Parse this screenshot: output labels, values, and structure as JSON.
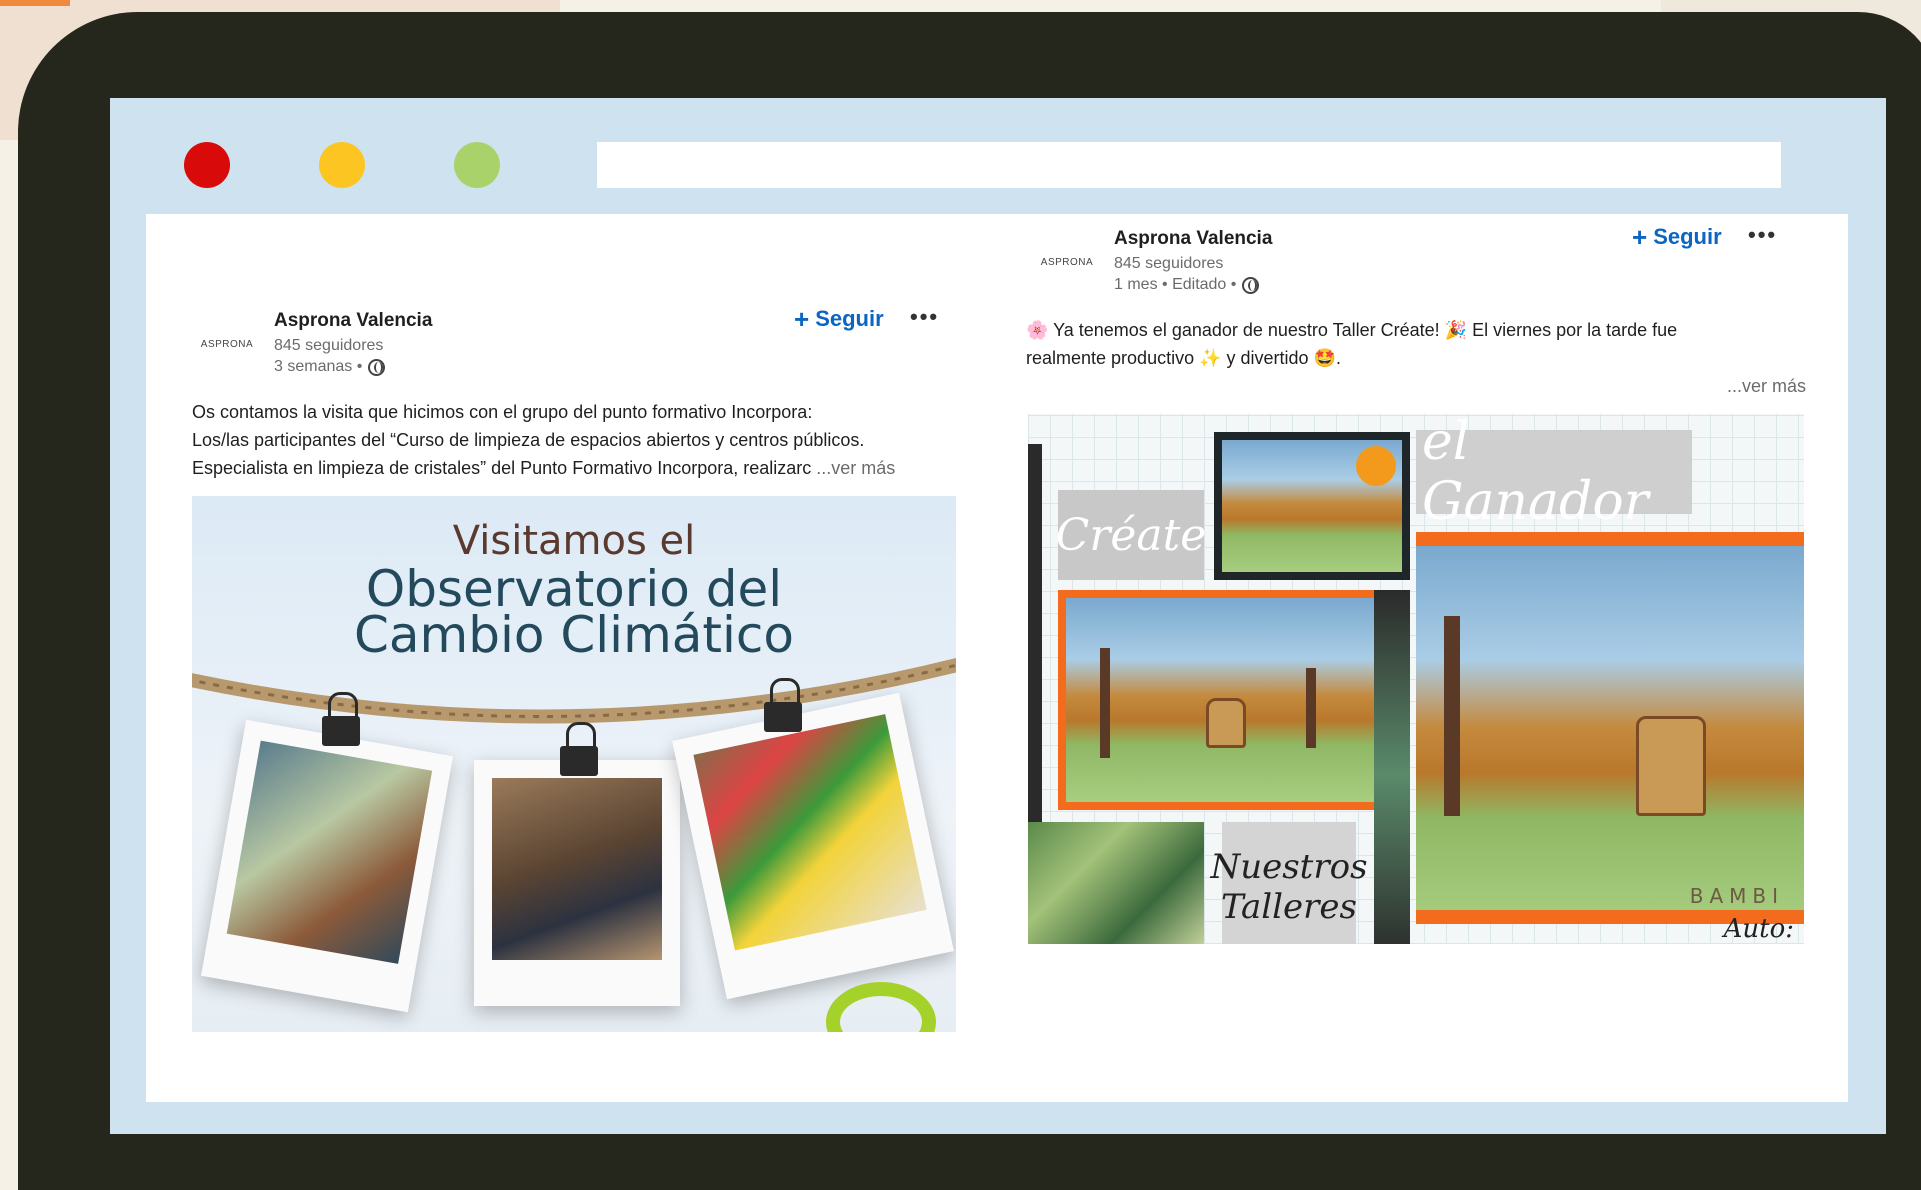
{
  "window": {
    "controls": [
      "close",
      "minimize",
      "maximize"
    ],
    "address_bar_value": ""
  },
  "posts": [
    {
      "logo_text": "ASPRONA",
      "author": "Asprona Valencia",
      "followers": "845 seguidores",
      "meta": "3 semanas •",
      "follow_label": "Seguir",
      "more_label": "•••",
      "text_lines": [
        "Os contamos la visita que hicimos con el grupo del punto formativo Incorpora:",
        "Los/las participantes del “Curso de limpieza de espacios abiertos y centros públicos.",
        "Especialista en limpieza de cristales” del Punto Formativo Incorpora, realizarc"
      ],
      "see_more": "...ver más",
      "image": {
        "title_line1": "Visitamos el",
        "title_line2": "Observatorio del",
        "title_line3": "Cambio Climático"
      }
    },
    {
      "logo_text": "ASPRONA",
      "author": "Asprona Valencia",
      "followers": "845 seguidores",
      "meta": "1 mes • Editado •",
      "follow_label": "Seguir",
      "more_label": "•••",
      "text_line1": "🌸 Ya tenemos el ganador de nuestro Taller Créate! 🎉 El viernes por la tarde fue",
      "text_line2": "realmente productivo ✨ y divertido 🤩.",
      "see_more": "...ver más",
      "image": {
        "label_create": "Créate",
        "label_ganador": "el Ganador",
        "label_nuestros": "Nuestros",
        "label_talleres": "Talleres",
        "painting_signature": "BAMBI",
        "corner_text": "Auto:"
      }
    }
  ],
  "colors": {
    "device_frame": "#26271c",
    "screen": "#cfe2ef",
    "dot_red": "#d80a0a",
    "dot_yellow": "#fcc521",
    "dot_green": "#a9d36a",
    "link_blue": "#0a66c2",
    "frame_orange": "#f36b1c"
  },
  "icons": [
    "globe-icon",
    "plus-icon",
    "more-icon"
  ]
}
